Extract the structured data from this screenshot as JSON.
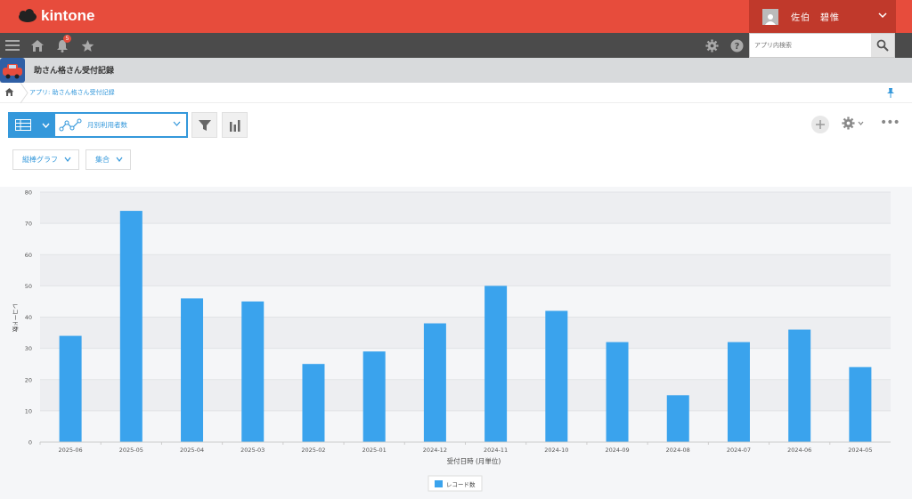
{
  "header": {
    "logo": "kintone",
    "user_name": "佐伯　碧惟"
  },
  "nav": {
    "notification_count": "5",
    "search_placeholder": "アプリ内検索"
  },
  "app": {
    "title": "助さん格さん受付記録"
  },
  "breadcrumb": {
    "text": "アプリ: 助さん格さん受付記録"
  },
  "toolbar": {
    "view_name": "月別利用者数",
    "graph_type": "縦棒グラフ",
    "aggregate": "集合"
  },
  "colors": {
    "brand": "#e74c3c",
    "accent": "#3498db",
    "bar": "#3aa3ed"
  },
  "chart_data": {
    "type": "bar",
    "categories": [
      "2025-06",
      "2025-05",
      "2025-04",
      "2025-03",
      "2025-02",
      "2025-01",
      "2024-12",
      "2024-11",
      "2024-10",
      "2024-09",
      "2024-08",
      "2024-07",
      "2024-06",
      "2024-05"
    ],
    "series": [
      {
        "name": "レコード数",
        "values": [
          34,
          74,
          46,
          45,
          25,
          29,
          38,
          50,
          42,
          32,
          15,
          32,
          36,
          24
        ]
      }
    ],
    "ylim": [
      0,
      80
    ],
    "yticks": [
      "0",
      "10",
      "20",
      "30",
      "40",
      "50",
      "60",
      "70",
      "80"
    ],
    "xlabel": "受付日時 (月単位)",
    "ylabel": "レコード数",
    "grid": true,
    "legend": "bottom-center"
  }
}
